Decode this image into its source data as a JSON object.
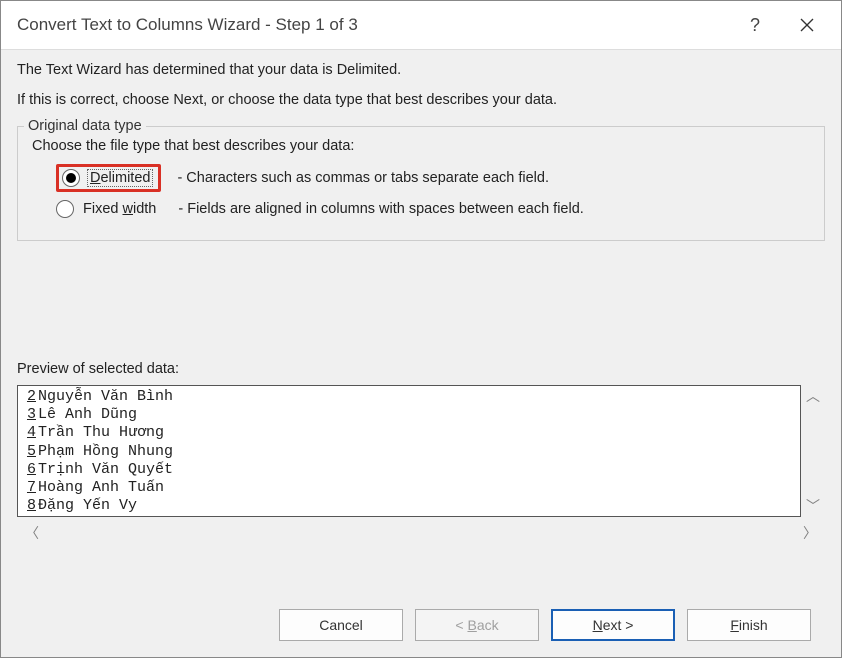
{
  "titlebar": {
    "title": "Convert Text to Columns Wizard - Step 1 of 3",
    "help": "?"
  },
  "intro": {
    "line1": "The Text Wizard has determined that your data is Delimited.",
    "line2": "If this is correct, choose Next, or choose the data type that best describes your data."
  },
  "fieldset": {
    "legend": "Original data type",
    "choose": "Choose the file type that best describes your data:",
    "options": [
      {
        "label_pre": "D",
        "label_rest": "elimited",
        "desc": "- Characters such as commas or tabs separate each field.",
        "selected": true,
        "highlighted": true
      },
      {
        "label_pre": "Fixed ",
        "label_u": "w",
        "label_post": "idth",
        "desc": "- Fields are aligned in columns with spaces between each field.",
        "selected": false,
        "highlighted": false
      }
    ]
  },
  "preview": {
    "label": "Preview of selected data:",
    "rows": [
      {
        "n": "2",
        "text": "Nguyễn Văn Bình"
      },
      {
        "n": "3",
        "text": "Lê Anh Dũng"
      },
      {
        "n": "4",
        "text": "Trần Thu Hương"
      },
      {
        "n": "5",
        "text": "Phạm Hồng Nhung"
      },
      {
        "n": "6",
        "text": "Trịnh Văn Quyết"
      },
      {
        "n": "7",
        "text": "Hoàng Anh Tuấn"
      },
      {
        "n": "8",
        "text": "Đặng Yến Vy"
      }
    ]
  },
  "buttons": {
    "cancel": "Cancel",
    "back_lt": "< ",
    "back_u": "B",
    "back_rest": "ack",
    "next_u": "N",
    "next_rest": "ext >",
    "finish_u": "F",
    "finish_rest": "inish"
  }
}
